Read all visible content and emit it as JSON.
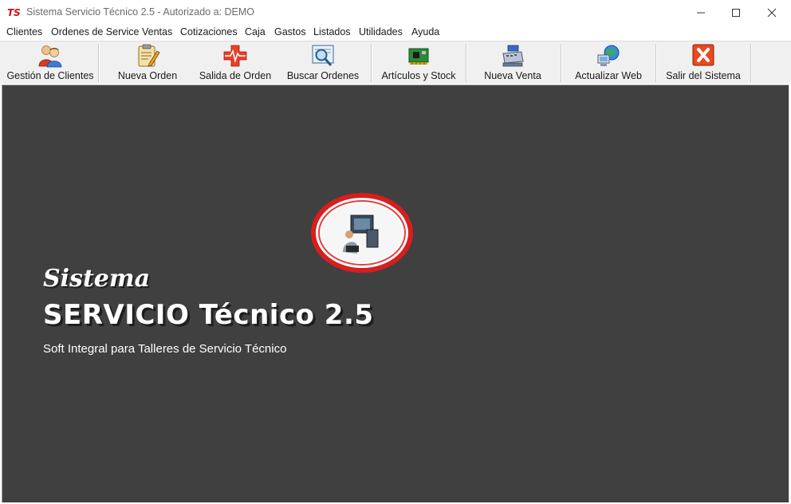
{
  "window": {
    "title": "Sistema Servicio Técnico 2.5 - Autorizado a: DEMO",
    "app_icon_text": "TS"
  },
  "menu": [
    "Clientes",
    "Ordenes de Service",
    "Ventas",
    "Cotizaciones",
    "Caja",
    "Gastos",
    "Listados",
    "Utilidades",
    "Ayuda"
  ],
  "toolbar": [
    {
      "label": "Gestión de Clientes",
      "icon": "users-icon"
    },
    {
      "label": "Nueva Orden",
      "icon": "clipboard-pencil-icon"
    },
    {
      "label": "Salida de Orden",
      "icon": "heartbeat-cross-icon"
    },
    {
      "label": "Buscar Ordenes",
      "icon": "magnifier-document-icon"
    },
    {
      "label": "Artículos y Stock",
      "icon": "circuit-board-icon"
    },
    {
      "label": "Nueva Venta",
      "icon": "cash-register-icon"
    },
    {
      "label": "Actualizar Web",
      "icon": "globe-computer-icon"
    },
    {
      "label": "Salir del Sistema",
      "icon": "exit-x-icon"
    }
  ],
  "splash": {
    "line1": "Sistema",
    "line2": "SERVICIO Técnico 2.5",
    "line3": "Soft Integral para Talleres de Servicio Técnico"
  },
  "colors": {
    "workspace": "#404040",
    "accent_red": "#e02020",
    "toolbar_bg": "#f0f0f0"
  }
}
